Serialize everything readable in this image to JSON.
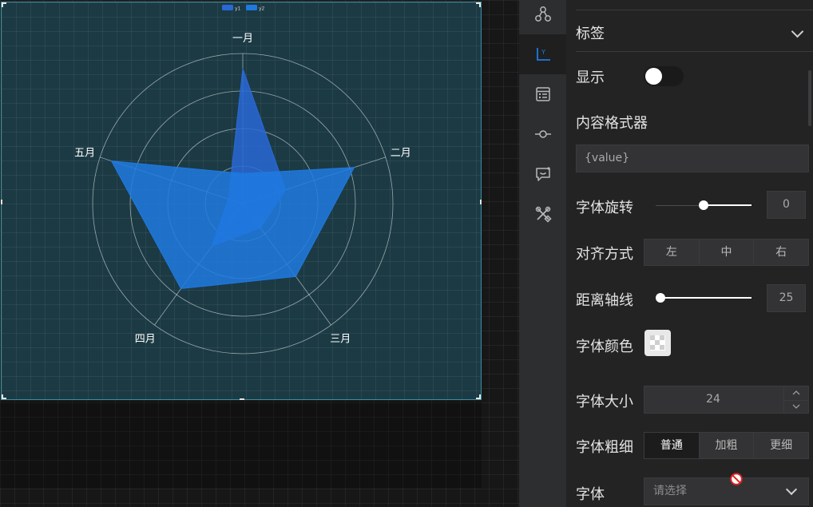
{
  "chart_data": {
    "type": "radar",
    "indicators": [
      "一月",
      "二月",
      "三月",
      "四月",
      "五月"
    ],
    "max": 100,
    "rings": 4,
    "legend_position": "top-center",
    "series": [
      {
        "name": "y1",
        "color": "#2969d6",
        "values": [
          90,
          30,
          20,
          35,
          10
        ]
      },
      {
        "name": "y2",
        "color": "#1f7ae0",
        "values": [
          20,
          78,
          60,
          70,
          92
        ]
      }
    ]
  },
  "panel": {
    "section_title": "标签",
    "show_label": "显示",
    "show_on": false,
    "formatter_label": "内容格式器",
    "formatter_value": "{value}",
    "rotate_label": "字体旋转",
    "rotate_value": "0",
    "rotate_min": -90,
    "rotate_max": 90,
    "align_label": "对齐方式",
    "align_options": [
      "左",
      "中",
      "右"
    ],
    "align_selected": "",
    "distance_label": "距离轴线",
    "distance_value": "25",
    "distance_max": 500,
    "color_label": "字体颜色",
    "size_label": "字体大小",
    "size_value": "24",
    "weight_label": "字体粗细",
    "weight_options": [
      "普通",
      "加粗",
      "更细"
    ],
    "weight_selected": "普通",
    "font_label": "字体",
    "font_placeholder": "请选择"
  },
  "strip_icons": [
    "nodes-icon",
    "axis-icon",
    "list-icon",
    "connector-icon",
    "message-icon",
    "tools-icon"
  ],
  "colors": {
    "accent": "#1f7ae0",
    "panel_bg": "#232324",
    "chart_bg": "#1c3a44"
  }
}
